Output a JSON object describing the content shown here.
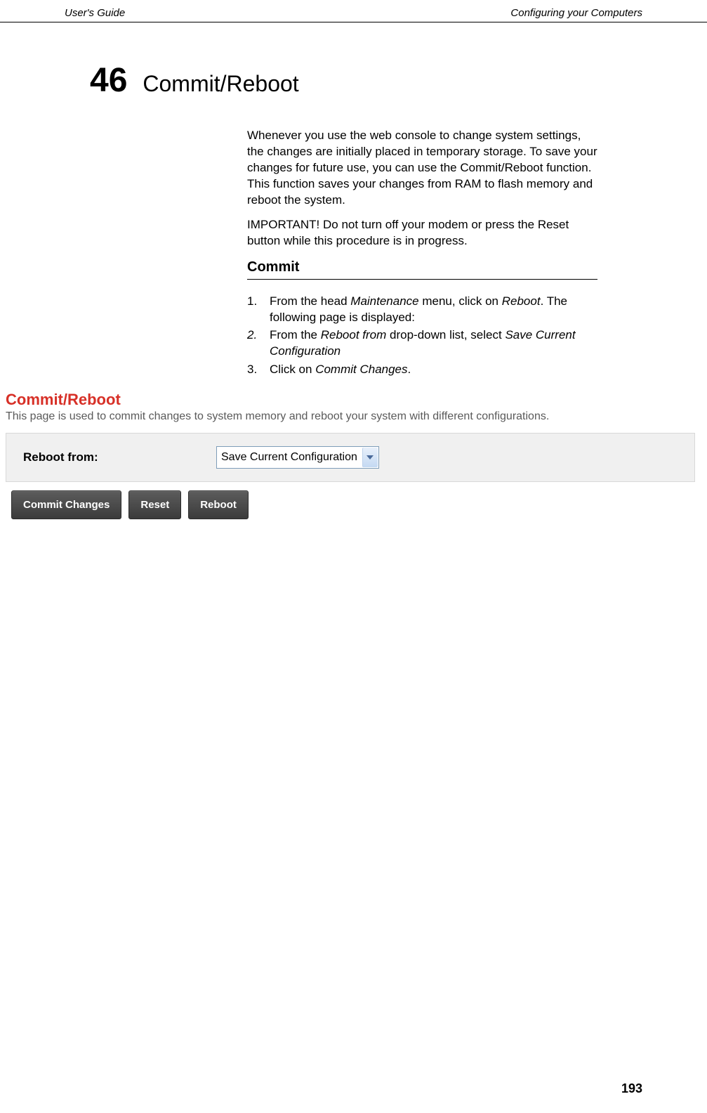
{
  "header": {
    "left": "User's Guide",
    "right": "Configuring your Computers"
  },
  "chapter": {
    "number": "46",
    "title": "Commit/Reboot"
  },
  "intro_paragraphs": [
    "Whenever you use the web console to change system settings, the changes are initially placed in temporary storage. To save your changes for future use, you can use the Commit/Reboot function. This function saves your changes from RAM to flash memory and reboot the system.",
    "IMPORTANT! Do not turn off your modem or press the Reset button while this procedure is in progress."
  ],
  "section_heading": "Commit",
  "steps": [
    {
      "number": "1.",
      "number_italic": false,
      "parts": [
        {
          "text": "From the head ",
          "italic": false
        },
        {
          "text": "Maintenance",
          "italic": true
        },
        {
          "text": " menu, click on ",
          "italic": false
        },
        {
          "text": "Reboot",
          "italic": true
        },
        {
          "text": ". The following page is displayed:",
          "italic": false
        }
      ]
    },
    {
      "number": "2.",
      "number_italic": true,
      "parts": [
        {
          "text": "From the ",
          "italic": false
        },
        {
          "text": "Reboot from",
          "italic": true
        },
        {
          "text": " drop-down list, select ",
          "italic": false
        },
        {
          "text": "Save Current Configuration",
          "italic": true
        }
      ]
    },
    {
      "number": "3.",
      "number_italic": false,
      "parts": [
        {
          "text": "Click on ",
          "italic": false
        },
        {
          "text": "Commit Changes",
          "italic": true
        },
        {
          "text": ".",
          "italic": false
        }
      ]
    }
  ],
  "screenshot": {
    "title": "Commit/Reboot",
    "description": "This page is used to commit changes to system memory and reboot your system with different configurations.",
    "form_label": "Reboot from:",
    "select_value": "Save Current Configuration",
    "buttons": {
      "commit": "Commit Changes",
      "reset": "Reset",
      "reboot": "Reboot"
    }
  },
  "page_number": "193"
}
